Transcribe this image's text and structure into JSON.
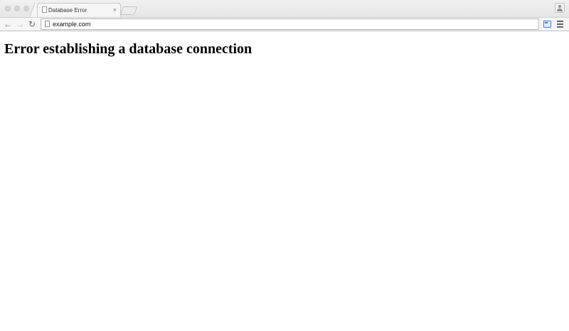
{
  "window": {
    "tab": {
      "title": "Database Error",
      "close_glyph": "×",
      "favicon": "page-icon"
    },
    "new_tab": "new-tab-icon",
    "profile": "person-icon"
  },
  "toolbar": {
    "back_glyph": "←",
    "forward_glyph": "→",
    "reload_glyph": "↻",
    "url": "example.com",
    "extension": "extension-icon",
    "menu": "hamburger-menu-icon"
  },
  "page": {
    "heading": "Error establishing a database connection"
  },
  "colors": {
    "accent": "#3d7fd8",
    "background": "#ffffff",
    "text": "#000000"
  }
}
